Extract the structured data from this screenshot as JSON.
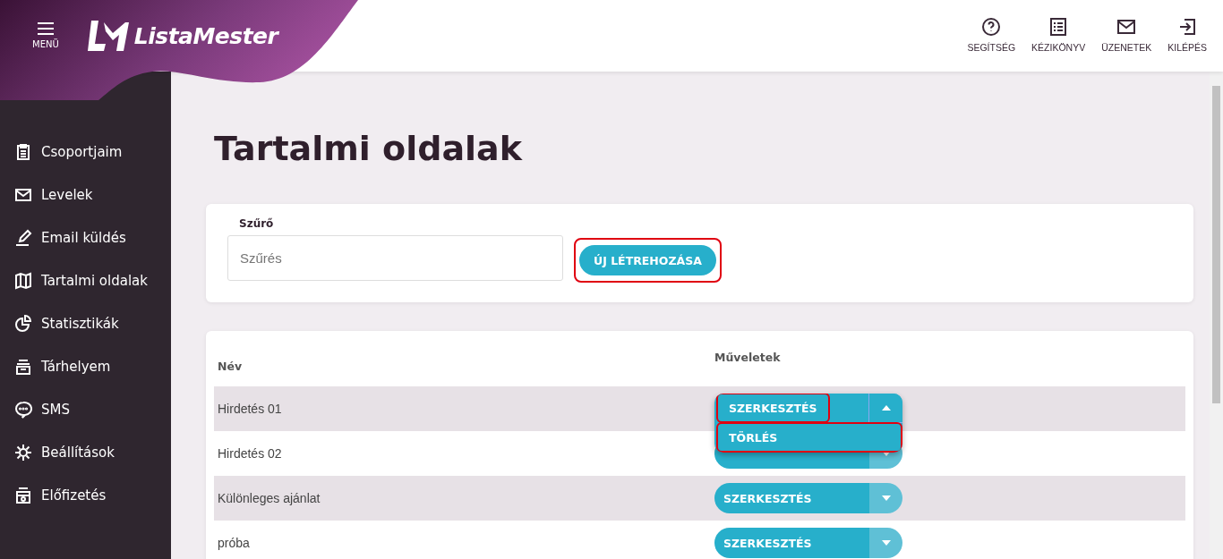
{
  "header": {
    "menu_label": "MENÜ",
    "logo_text": "ListaMester",
    "links": [
      {
        "kind": "help",
        "label": "SEGÍTSÉG"
      },
      {
        "kind": "manual",
        "label": "KÉZIKÖNYV"
      },
      {
        "kind": "messages",
        "label": "ÜZENETEK"
      },
      {
        "kind": "logout",
        "label": "KILÉPÉS"
      }
    ]
  },
  "sidebar": {
    "items": [
      {
        "kind": "groups",
        "label": "Csoportjaim"
      },
      {
        "kind": "mail",
        "label": "Levelek"
      },
      {
        "kind": "send",
        "label": "Email küldés"
      },
      {
        "kind": "pages",
        "label": "Tartalmi oldalak"
      },
      {
        "kind": "stats",
        "label": "Statisztikák"
      },
      {
        "kind": "storage",
        "label": "Tárhelyem"
      },
      {
        "kind": "sms",
        "label": "SMS"
      },
      {
        "kind": "settings",
        "label": "Beállítások"
      },
      {
        "kind": "subscription",
        "label": "Előfizetés"
      }
    ]
  },
  "page_title": "Tartalmi oldalak",
  "filter": {
    "label": "Szűrő",
    "placeholder": "Szűrés",
    "create_button": {
      "label": "ÚJ LÉTREHOZÁSA",
      "highlighted": true
    }
  },
  "table": {
    "columns": [
      "Név",
      "Műveletek"
    ],
    "rows": [
      {
        "name": "Hirdetés 01",
        "action": {
          "label": "SZERKESZTÉS",
          "highlighted": true
        },
        "open": true,
        "menu": [
          {
            "label": "TÖRLÉS",
            "highlighted": true
          }
        ]
      },
      {
        "name": "Hirdetés 02",
        "action": {
          "highlighted": false
        },
        "open": false
      },
      {
        "name": "Különleges ajánlat",
        "action": {
          "label": "SZERKESZTÉS",
          "highlighted": false
        },
        "open": false
      },
      {
        "name": "próba",
        "action": {
          "label": "SZERKESZTÉS",
          "highlighted": false
        },
        "open": false
      }
    ]
  }
}
